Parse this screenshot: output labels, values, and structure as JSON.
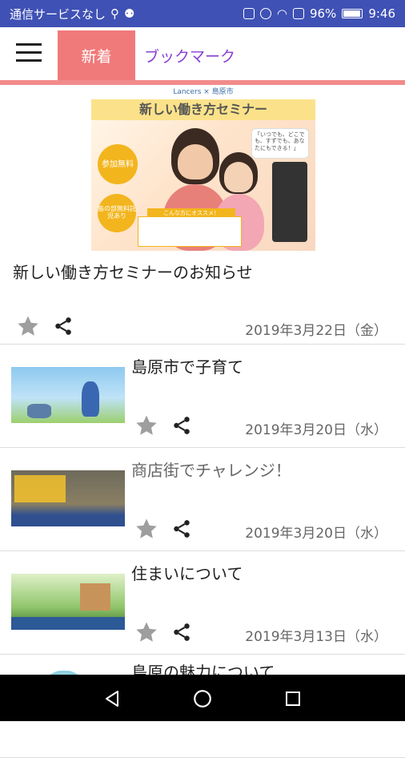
{
  "status_bar": {
    "carrier": "通信サービスなし",
    "battery": "96%",
    "time": "9:46"
  },
  "tabs": [
    {
      "label": "新着",
      "active": true
    },
    {
      "label": "ブックマーク",
      "active": false
    }
  ],
  "featured": {
    "banner": {
      "header": "Lancers × 島原市",
      "title": "新しい働き方セミナー",
      "badge_1": "参加無料",
      "badge_2": "島の部無料託児あり",
      "bubble": "「いつでも、どこでも、すずでも、あなたにもできる！」",
      "note_head": "こんな方にオススメ！"
    },
    "title": "新しい働き方セミナーのお知らせ",
    "date": "2019年3月22日（金）"
  },
  "articles": [
    {
      "title": "島原市で子育て",
      "date": "2019年3月20日（水）",
      "muted": false,
      "thumb": "kids"
    },
    {
      "title": "商店街でチャレンジ！",
      "date": "2019年3月20日（水）",
      "muted": true,
      "thumb": "shop"
    },
    {
      "title": "住まいについて",
      "date": "2019年3月13日（水）",
      "muted": false,
      "thumb": "house"
    },
    {
      "title": "島原の魅力について",
      "date": "",
      "muted": false,
      "thumb": "charm"
    }
  ],
  "colors": {
    "status_bar": "#3f51b5",
    "tab_active": "#f07a7a",
    "tab_underline": "#f28b8b",
    "tab_inactive_text": "#8a3fd1",
    "star": "#9e9e9e"
  }
}
